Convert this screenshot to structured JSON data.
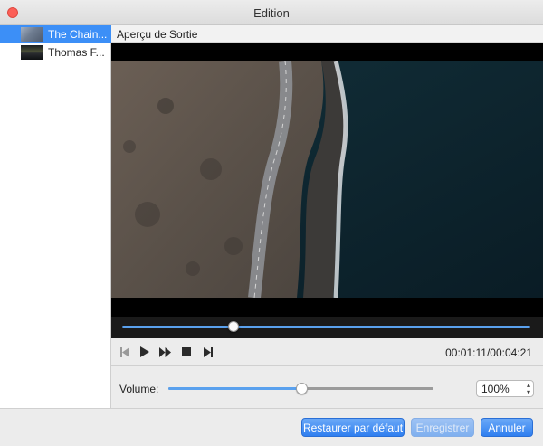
{
  "window": {
    "title": "Edition"
  },
  "sidebar": {
    "items": [
      {
        "label": "The Chain...",
        "selected": true,
        "thumb": "blue-grey"
      },
      {
        "label": "Thomas F...",
        "selected": false,
        "thumb": "dark-landscape"
      }
    ]
  },
  "preview": {
    "header": "Aperçu de Sortie",
    "seek_progress": 0.272
  },
  "player": {
    "time": "00:01:11/00:04:21",
    "icons": [
      "skip-back-icon",
      "play-icon",
      "fast-forward-icon",
      "stop-icon",
      "skip-forward-icon"
    ]
  },
  "volume": {
    "label": "Volume:",
    "level": 0.5,
    "select_value": "100%"
  },
  "footer": {
    "restore_label": "Restaurer par défaut",
    "save_label": "Enregistrer",
    "cancel_label": "Annuler"
  },
  "colors": {
    "accent": "#3c8ff7",
    "close": "#fc5f57",
    "progress": "#5aa1ee"
  }
}
